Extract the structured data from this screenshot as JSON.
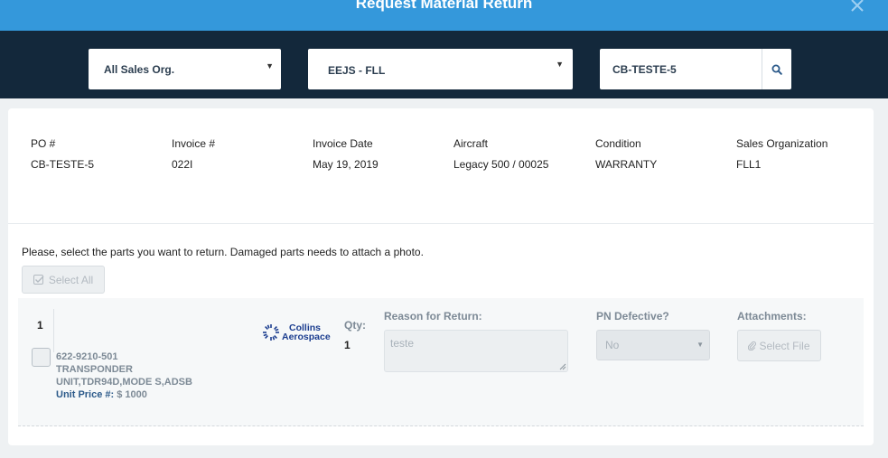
{
  "modal": {
    "title": "Request Material Return"
  },
  "filters": {
    "sales_org": "All Sales Org.",
    "customer": "EEJS - FLL",
    "search_value": "CB-TESTE-5"
  },
  "order": {
    "po_label": "PO #",
    "po_value": "CB-TESTE-5",
    "invoice_label": "Invoice #",
    "invoice_value": "022I",
    "invoice_date_label": "Invoice Date",
    "invoice_date_value": "May 19, 2019",
    "aircraft_label": "Aircraft",
    "aircraft_value": "Legacy 500 / 00025",
    "condition_label": "Condition",
    "condition_value": "WARRANTY",
    "sales_org_label": "Sales Organization",
    "sales_org_value": "FLL1"
  },
  "instructions": "Please, select the parts you want to return. Damaged parts needs to attach a photo.",
  "select_all_label": "Select All",
  "items": [
    {
      "number": "1",
      "part_number": "622-9210-501",
      "description": "TRANSPONDER UNIT,TDR94D,MODE S,ADSB",
      "unit_price_label": "Unit Price #:",
      "unit_price_value": "$ 1000",
      "logo_line1": "Collins",
      "logo_line2": "Aerospace",
      "qty_label": "Qty:",
      "qty_value": "1",
      "reason_label": "Reason for Return:",
      "reason_value": "teste",
      "pn_defective_label": "PN Defective?",
      "pn_defective_value": "No",
      "attachments_label": "Attachments:",
      "select_file_label": "Select File"
    }
  ],
  "colors": {
    "header": "#3498db",
    "filter_bar": "#13283b",
    "logo": "#1b3d8f"
  },
  "icons": {
    "close": "close-icon",
    "search": "search-icon",
    "check": "check-icon",
    "paperclip": "paperclip-icon",
    "caret": "caret-down-icon"
  }
}
